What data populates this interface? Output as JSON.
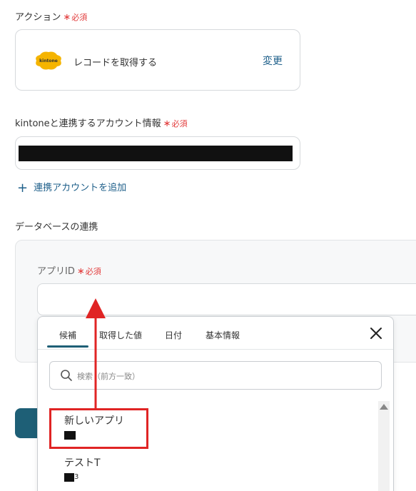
{
  "action_section": {
    "label": "アクション",
    "required_mark": "∗",
    "required_text": "必須",
    "card": {
      "logo_text": "kintone",
      "action_name": "レコードを取得する",
      "change_label": "変更"
    }
  },
  "account_section": {
    "label": "kintoneと連携するアカウント情報",
    "required_mark": "∗",
    "required_text": "必須",
    "add_account_label": "連携アカウントを追加"
  },
  "database_section": {
    "label": "データベースの連携",
    "app_id": {
      "label": "アプリID",
      "required_mark": "∗",
      "required_text": "必須"
    }
  },
  "dropdown": {
    "tabs": [
      {
        "label": "候補"
      },
      {
        "label": "取得した値"
      },
      {
        "label": "日付"
      },
      {
        "label": "基本情報"
      }
    ],
    "active_tab": "候補",
    "search_placeholder": "検索（前方一致）",
    "items": [
      {
        "title": "新しいアプリ",
        "sub": ""
      },
      {
        "title": "テストT",
        "sub": "3"
      }
    ]
  },
  "colors": {
    "accent": "#1e5f76",
    "link": "#1e5f8a",
    "required": "#e23b3b",
    "annotation": "#e02424",
    "kintone_yellow": "#f5b400"
  },
  "icons": [
    "kintone-logo-icon",
    "plus-icon",
    "close-icon",
    "search-icon",
    "scroll-up-icon"
  ]
}
